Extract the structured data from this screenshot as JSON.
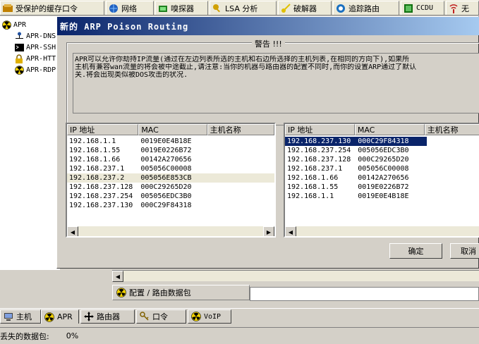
{
  "top_tabs": [
    {
      "label": "受保护的缓存口令",
      "icon": "cached-passwords-icon"
    },
    {
      "label": "网络",
      "icon": "network-globe-icon"
    },
    {
      "label": "嗅探器",
      "icon": "sniffer-icon"
    },
    {
      "label": "LSA 分析",
      "icon": "lsa-key-icon"
    },
    {
      "label": "破解器",
      "icon": "cracker-key-icon"
    },
    {
      "label": "追踪路由",
      "icon": "traceroute-icon"
    },
    {
      "label": "CCDU",
      "icon": "ccdu-icon"
    },
    {
      "label": "无",
      "icon": "wireless-icon"
    }
  ],
  "tree": {
    "root": "APR",
    "items": [
      "APR-DNS",
      "APR-SSH",
      "APR-HTTPS",
      "APR-RDP"
    ]
  },
  "dialog": {
    "title": "新的 ARP Poison Routing",
    "warning_title": "警告 !!!",
    "warning_lines": [
      "APR可以允许你劫持IP流量(通过在左边列表所选的主机和右边所选择的主机列表,在相同的方向下),如果所",
      "主机有兼容wan流量的将会被中途截止,请注意:当你的机器与路由器的配置不同时,而你的设置ARP通过了默认",
      "关.将会出现类似被DOS攻击的状况."
    ],
    "columns": [
      "IP 地址",
      "MAC",
      "主机名称"
    ],
    "left_rows": [
      {
        "ip": "192.168.1.1",
        "mac": "0019E0E4B18E"
      },
      {
        "ip": "192.168.1.55",
        "mac": "0019E0226B72"
      },
      {
        "ip": "192.168.1.66",
        "mac": "00142A270656"
      },
      {
        "ip": "192.168.237.1",
        "mac": "005056C00008"
      },
      {
        "ip": "192.168.237.2",
        "mac": "005056E853CB"
      },
      {
        "ip": "192.168.237.128",
        "mac": "000C29265D20"
      },
      {
        "ip": "192.168.237.254",
        "mac": "005056EDC3B0"
      },
      {
        "ip": "192.168.237.130",
        "mac": "000C29F84318"
      }
    ],
    "right_rows": [
      {
        "ip": "192.168.237.130",
        "mac": "000C29F84318"
      },
      {
        "ip": "192.168.237.254",
        "mac": "005056EDC3B0"
      },
      {
        "ip": "192.168.237.128",
        "mac": "000C29265D20"
      },
      {
        "ip": "192.168.237.1",
        "mac": "005056C00008"
      },
      {
        "ip": "192.168.1.66",
        "mac": "00142A270656"
      },
      {
        "ip": "192.168.1.55",
        "mac": "0019E0226B72"
      },
      {
        "ip": "192.168.1.1",
        "mac": "0019E0E4B18E"
      }
    ],
    "ok_label": "确定",
    "cancel_label": "取消"
  },
  "lower": {
    "config_label": "配置 / 路由数据包"
  },
  "bottom_tabs": [
    {
      "label": "主机",
      "icon": "host-computer-icon"
    },
    {
      "label": "APR",
      "icon": "apr-radiation-icon"
    },
    {
      "label": "路由器",
      "icon": "router-cross-icon"
    },
    {
      "label": "口令",
      "icon": "password-keys-icon"
    },
    {
      "label": "VoIP",
      "icon": "voip-radiation-icon"
    }
  ],
  "status": {
    "lost_packets_label": "丢失的数据包:",
    "lost_packets_value": "0%"
  },
  "colors": {
    "selection": "#0a246a",
    "title_gradient_start": "#0a246a",
    "title_gradient_end": "#a6caf0"
  }
}
